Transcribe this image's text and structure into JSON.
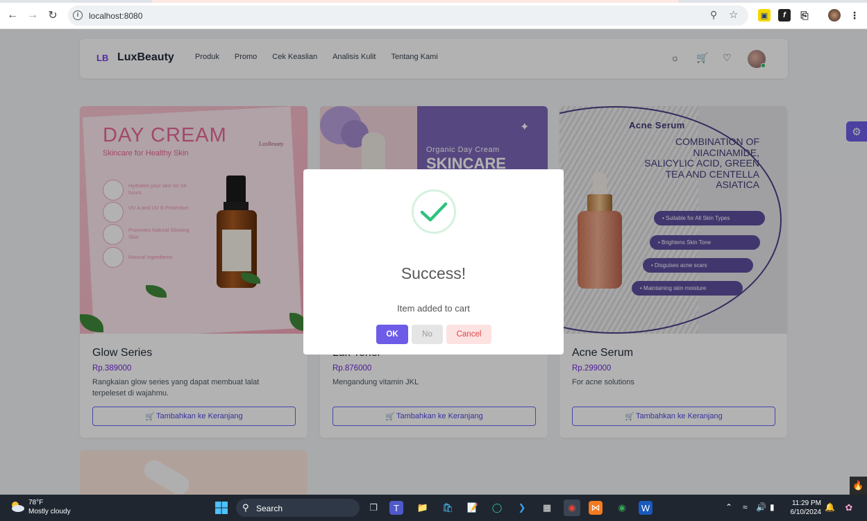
{
  "browser": {
    "url": "localhost:8080"
  },
  "nav": {
    "logo_mark": "LB",
    "logo_text": "LuxBeauty",
    "links": [
      "Produk",
      "Promo",
      "Cek Keaslian",
      "Analisis Kulit",
      "Tentang Kami"
    ]
  },
  "products": [
    {
      "name": "Glow Series",
      "price": "Rp.389000",
      "description": "Rangkaian glow series yang dapat membuat lalat terpeleset di wajahmu.",
      "button": "Tambahkan ke Keranjang",
      "image": {
        "title": "DAY CREAM",
        "subtitle": "Skincare for Healthy Skin",
        "brand": "LuxBeauty",
        "bullets": [
          "Hydrates your skin for 24 hours",
          "UV A and UV B Protection",
          "Promotes Natural Glowing Skin",
          "Natural Ingredients"
        ]
      }
    },
    {
      "name": "Lux Toner",
      "price": "Rp.876000",
      "description": "Mengandung vitamin JKL",
      "button": "Tambahkan ke Keranjang",
      "image": {
        "title": "Organic Day Cream",
        "subtitle": "SKINCARE"
      }
    },
    {
      "name": "Acne Serum",
      "price": "Rp.299000",
      "description": "For acne solutions",
      "button": "Tambahkan ke Keranjang",
      "image": {
        "title": "Acne Serum",
        "subtitle": "COMBINATION OF NIACINAMIDE, SALICYLIC ACID, GREEN TEA AND CENTELLA ASIATICA",
        "pills": [
          "• Suitable for All Skin Types",
          "• Brightens Skin Tone",
          "• Disguises acne scars",
          "• Maintaining skin moisture"
        ]
      }
    }
  ],
  "modal": {
    "title": "Success!",
    "message": "Item added to cart",
    "ok": "OK",
    "no": "No",
    "cancel": "Cancel"
  },
  "taskbar": {
    "temperature": "78°F",
    "weather": "Mostly cloudy",
    "search": "Search",
    "time": "11:29 PM",
    "date": "6/10/2024"
  },
  "colors": {
    "accent": "#6d5ce7",
    "price": "#6d28d9",
    "success": "#2ec27e"
  }
}
